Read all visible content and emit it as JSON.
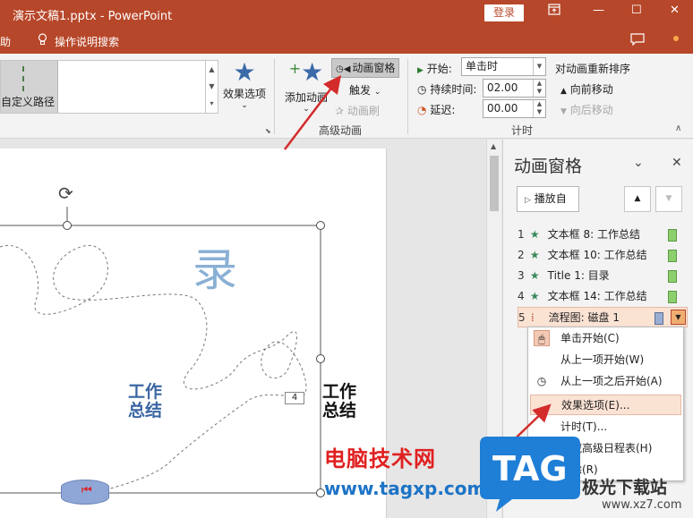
{
  "titlebar": {
    "title": "演示文稿1.pptx  -  PowerPoint",
    "login_label": "登录",
    "ribbon_display_icon": "ribbon-display-icon",
    "minimize_icon": "—",
    "restore_icon": "☐",
    "close_icon": "✕"
  },
  "menubar": {
    "help_label": "助",
    "search_label": "操作说明搜索"
  },
  "ribbon": {
    "gallery_selected_label": "自定义路径",
    "effect_options_label": "效果选项",
    "add_animation_label": "添加动画",
    "animation_pane_label": "动画窗格",
    "trigger_label": "触发",
    "animation_painter_label": "动画刷",
    "advanced_group_label": "高级动画",
    "start_label": "开始:",
    "start_value": "单击时",
    "duration_label": "持续时间:",
    "duration_value": "02.00",
    "delay_label": "延迟:",
    "delay_value": "00.00",
    "timing_group_label": "计时",
    "reorder_label": "对动画重新排序",
    "move_earlier_label": "向前移动",
    "move_later_label": "向后移动"
  },
  "slide": {
    "big_char": "录",
    "text_left": "工作\n总结",
    "text_left_line1": "工作",
    "text_left_line2": "总结",
    "text_right_line1": "工作",
    "text_right_line2": "总结",
    "path_badge": "4"
  },
  "animation_pane": {
    "title": "动画窗格",
    "play_label": "播放自",
    "items": [
      {
        "num": "1",
        "label": "文本框 8: 工作总结"
      },
      {
        "num": "2",
        "label": "文本框 10: 工作总结"
      },
      {
        "num": "3",
        "label": "Title 1:  目录"
      },
      {
        "num": "4",
        "label": "文本框 14: 工作总结"
      },
      {
        "num": "5",
        "label": "流程图: 磁盘 1"
      }
    ]
  },
  "context_menu": {
    "items": [
      "单击开始(C)",
      "从上一项开始(W)",
      "从上一项之后开始(A)",
      "效果选项(E)...",
      "计时(T)...",
      "隐藏高级日程表(H)",
      "删除(R)"
    ]
  },
  "watermark": {
    "site_text": "电脑技术网",
    "site_url": "www.tagxp.com",
    "tag_logo": "TAG",
    "site2_cn": "极光下载站",
    "site2_url": "www.xz7.com"
  },
  "colors": {
    "accent": "#b7472a",
    "highlight": "#fbe3d4",
    "arrow": "#d42b2b"
  }
}
